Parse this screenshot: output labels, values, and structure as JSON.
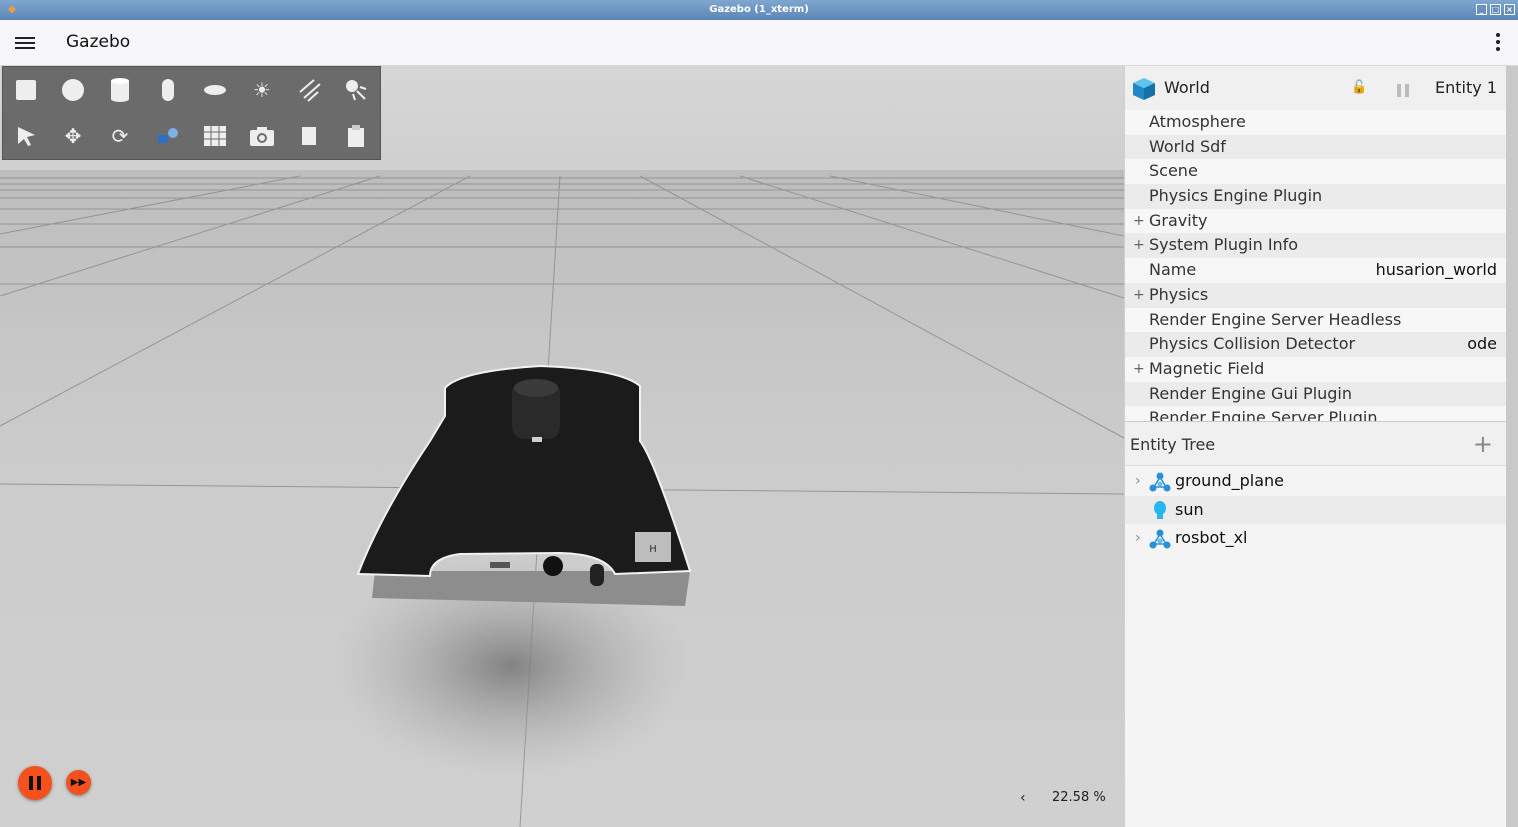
{
  "window": {
    "title": "Gazebo (1_xterm)"
  },
  "header": {
    "app_title": "Gazebo"
  },
  "toolbar": {
    "row1": [
      "box-icon",
      "sphere-icon",
      "cylinder-icon",
      "capsule-icon",
      "ellipsoid-icon",
      "sun-light-icon",
      "directional-light-icon",
      "spot-light-icon"
    ],
    "row2": [
      "select-arrow-icon",
      "translate-icon",
      "rotate-icon",
      "transform-control-icon",
      "grid-snap-icon",
      "camera-screenshot-icon",
      "copy-icon",
      "paste-icon"
    ]
  },
  "component_inspector": {
    "entity_name": "World",
    "entity_id": "Entity 1",
    "properties": [
      {
        "label": "Atmosphere",
        "expandable": false,
        "value": ""
      },
      {
        "label": "World Sdf",
        "expandable": false,
        "value": ""
      },
      {
        "label": "Scene",
        "expandable": false,
        "value": ""
      },
      {
        "label": "Physics Engine Plugin",
        "expandable": false,
        "value": ""
      },
      {
        "label": "Gravity",
        "expandable": true,
        "value": ""
      },
      {
        "label": "System Plugin Info",
        "expandable": true,
        "value": ""
      },
      {
        "label": "Name",
        "expandable": false,
        "value": "husarion_world"
      },
      {
        "label": "Physics",
        "expandable": true,
        "value": ""
      },
      {
        "label": "Render Engine Server Headless",
        "expandable": false,
        "value": ""
      },
      {
        "label": "Physics Collision Detector",
        "expandable": false,
        "value": "ode"
      },
      {
        "label": "Magnetic Field",
        "expandable": true,
        "value": ""
      },
      {
        "label": "Render Engine Gui Plugin",
        "expandable": false,
        "value": ""
      },
      {
        "label": "Render Engine Server Plugin",
        "expandable": false,
        "value": ""
      }
    ]
  },
  "entity_tree": {
    "title": "Entity Tree",
    "items": [
      {
        "name": "ground_plane",
        "icon": "model-icon",
        "expandable": true
      },
      {
        "name": "sun",
        "icon": "light-bulb-icon",
        "expandable": false
      },
      {
        "name": "rosbot_xl",
        "icon": "model-icon",
        "expandable": true
      }
    ]
  },
  "playback": {
    "real_time_factor": "22.58 %"
  },
  "colors": {
    "accent": "#f4511e",
    "panel": "#f4f4f4",
    "toolbar": "#6b6b6b"
  }
}
